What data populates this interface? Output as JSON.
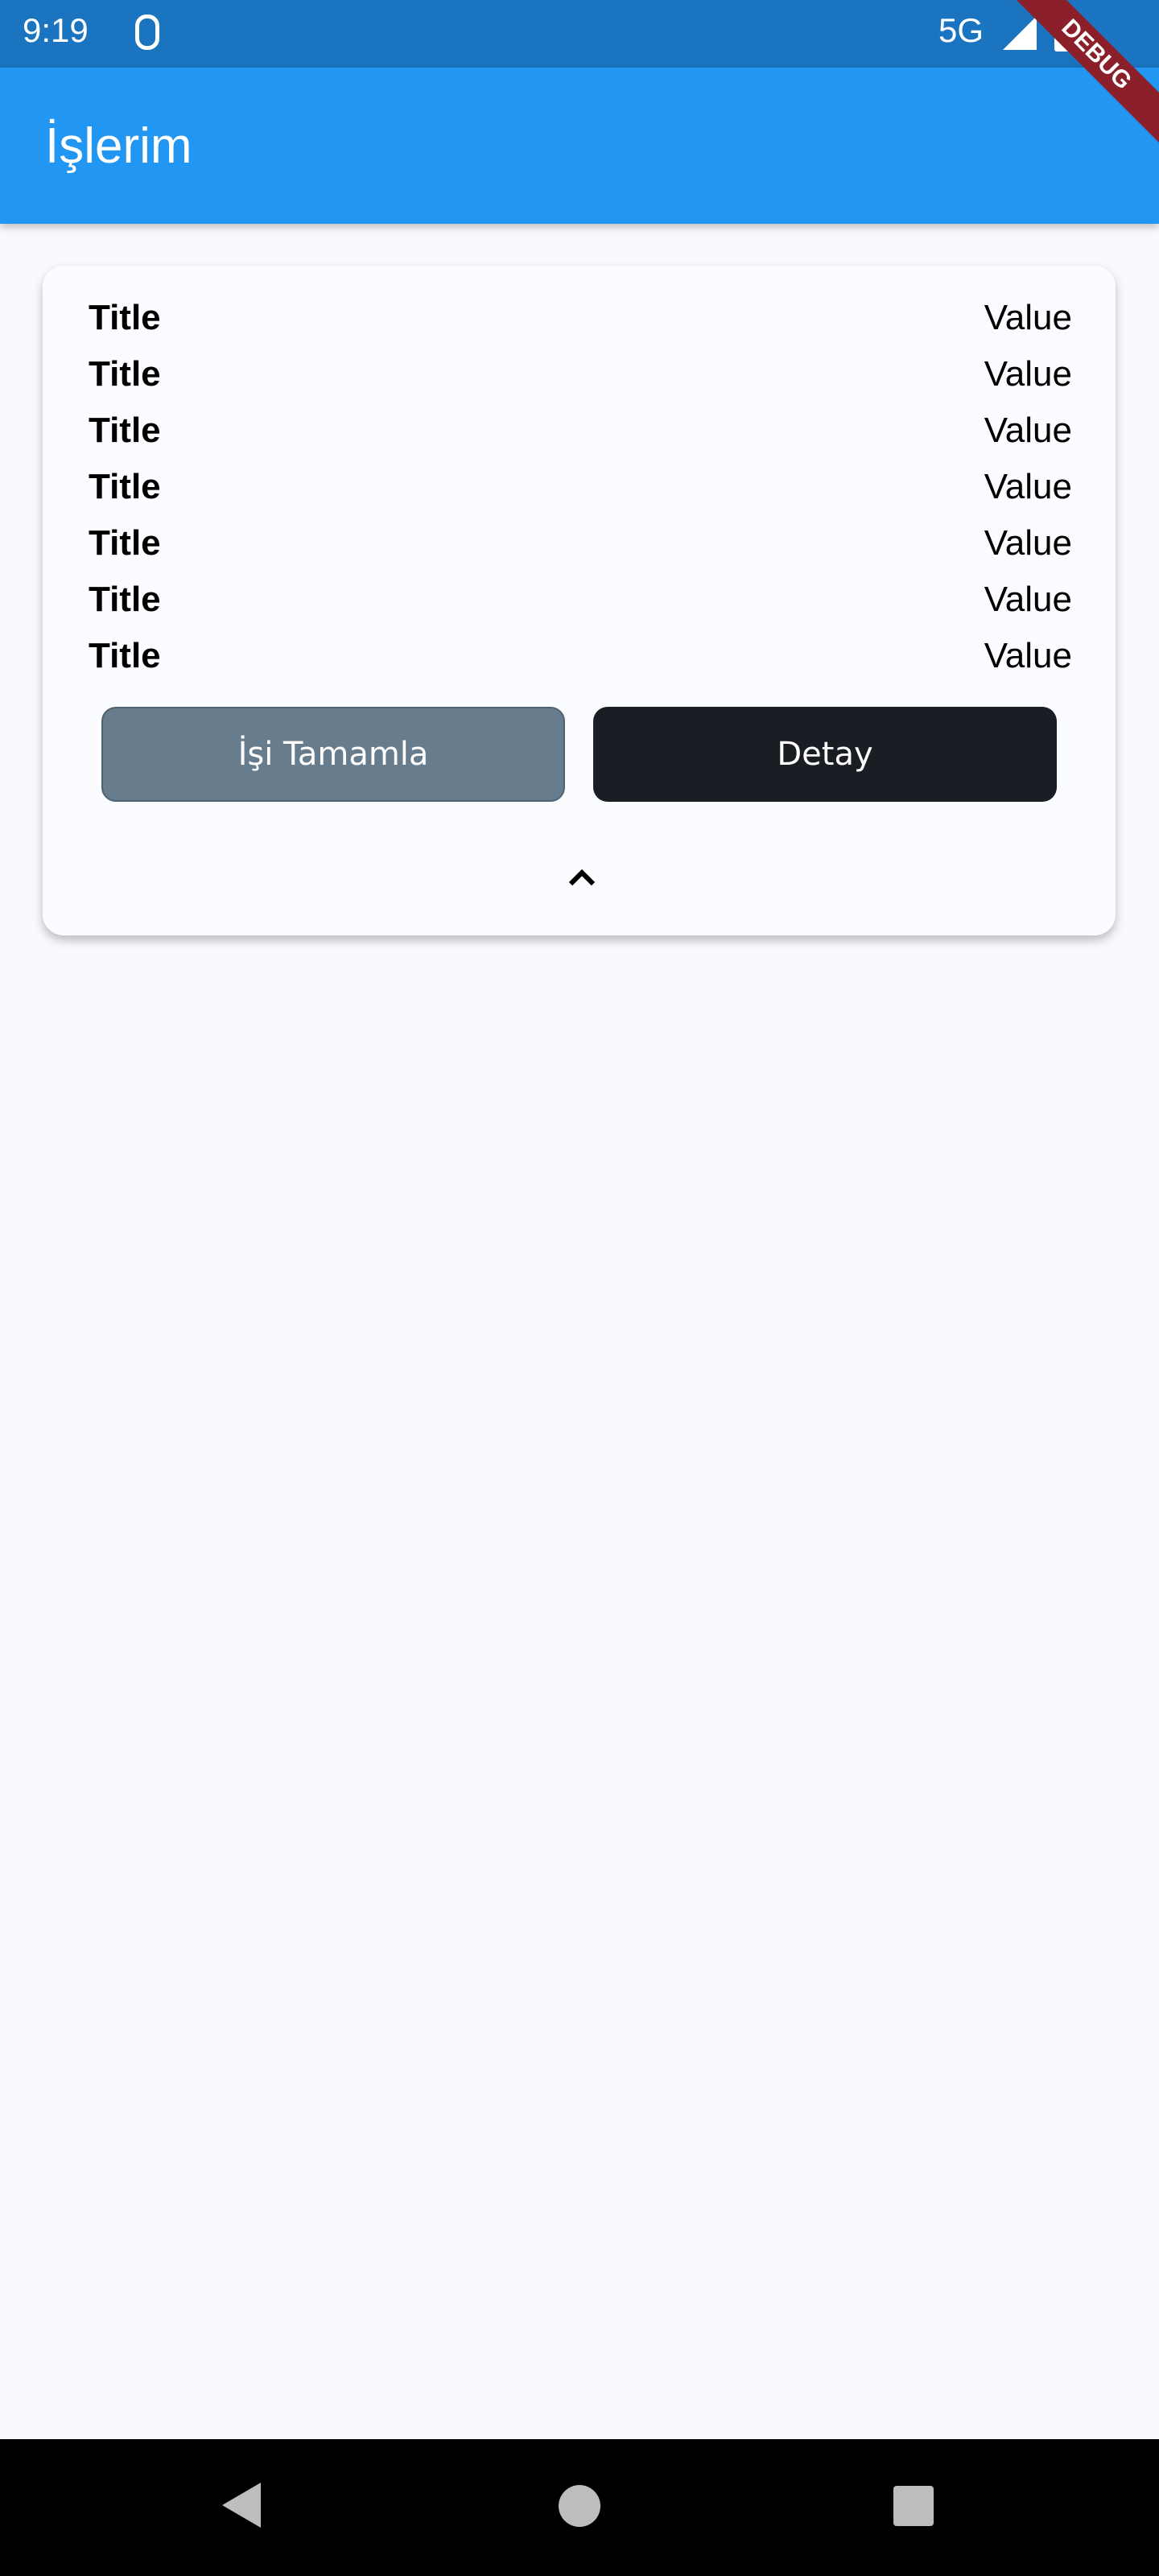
{
  "status_bar": {
    "time": "9:19",
    "network": "5G",
    "icons": [
      "notification-icon",
      "signal-icon",
      "battery-icon"
    ]
  },
  "debug_banner": "DEBUG",
  "app_bar": {
    "title": "İşlerim"
  },
  "card": {
    "rows": [
      {
        "title": "Title",
        "value": "Value"
      },
      {
        "title": "Title",
        "value": "Value"
      },
      {
        "title": "Title",
        "value": "Value"
      },
      {
        "title": "Title",
        "value": "Value"
      },
      {
        "title": "Title",
        "value": "Value"
      },
      {
        "title": "Title",
        "value": "Value"
      },
      {
        "title": "Title",
        "value": "Value"
      }
    ],
    "complete_button": "İşi Tamamla",
    "detail_button": "Detay",
    "collapse_icon": "chevron-up-icon"
  },
  "colors": {
    "status_bar": "#1a74c0",
    "app_bar": "#2196f3",
    "complete_button": "#677d8d",
    "detail_button": "#1b1d25"
  }
}
